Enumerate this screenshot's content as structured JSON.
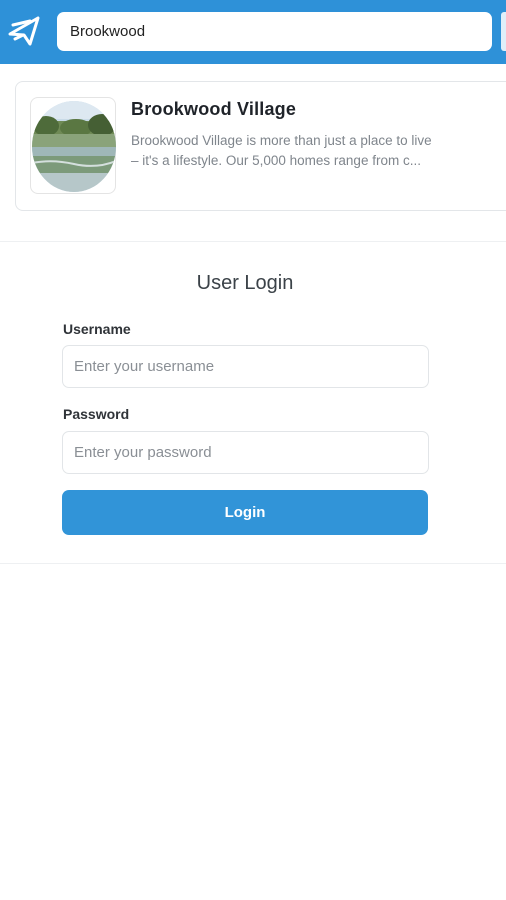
{
  "header": {
    "search_value": "Brookwood",
    "brand_color": "#2e91d8",
    "logo_icon": "paper-plane-icon"
  },
  "community": {
    "title": "Brookwood Village",
    "description_line1": "Brookwood Village is more than just a place to live",
    "description_line2": "– it's a lifestyle. Our 5,000 homes range from c...",
    "image": "lake-landscape-thumbnail"
  },
  "login": {
    "title": "User Login",
    "username_label": "Username",
    "username_placeholder": "Enter your username",
    "password_label": "Password",
    "password_placeholder": "Enter your password",
    "submit_label": "Login",
    "button_color": "#3194d8"
  }
}
